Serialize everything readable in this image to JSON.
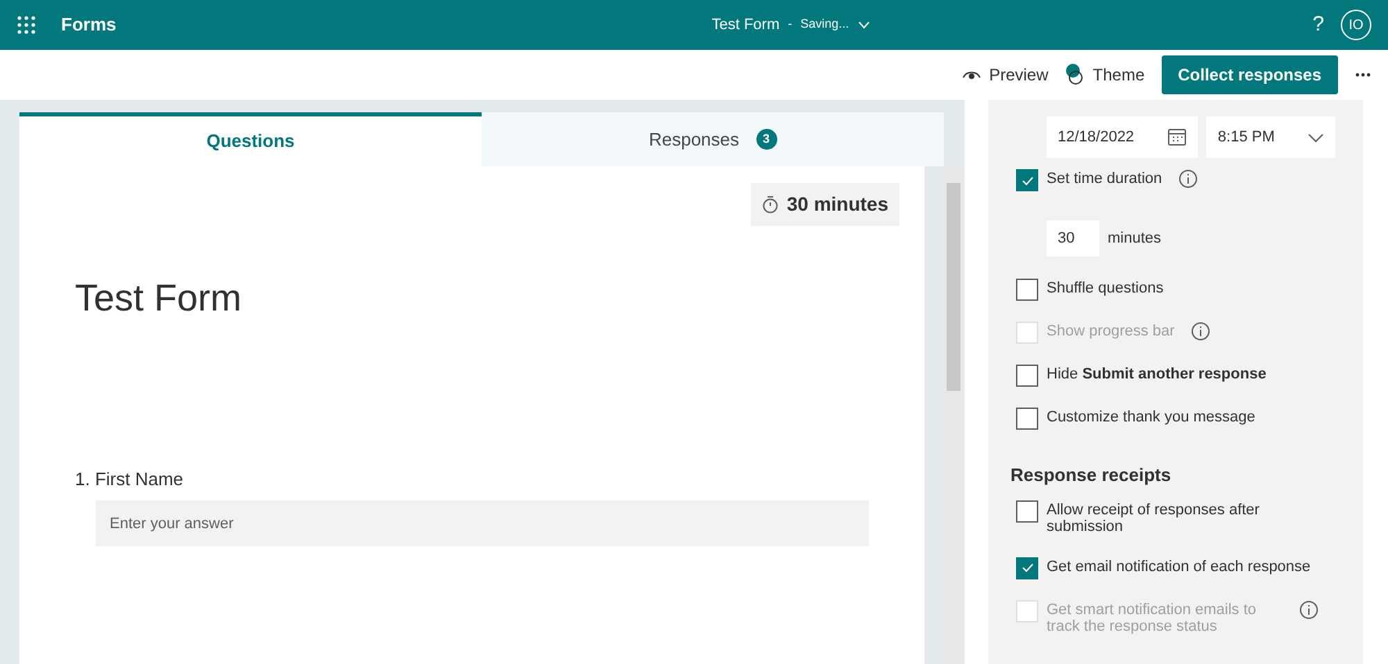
{
  "app_bar": {
    "app_name": "Forms",
    "form_title": "Test Form",
    "separator": "-",
    "save_status": "Saving...",
    "help": "?",
    "avatar": "IO"
  },
  "toolbar": {
    "preview": "Preview",
    "theme": "Theme",
    "collect": "Collect responses"
  },
  "tabs": [
    {
      "label": "Questions",
      "selected": true
    },
    {
      "label": "Responses",
      "selected": false,
      "count": "3"
    }
  ],
  "form": {
    "timer": "30 minutes",
    "title": "Test Form",
    "questions": [
      {
        "label": "1. First Name",
        "placeholder": "Enter your answer"
      }
    ]
  },
  "settings": [
    {
      "kind": "datetime",
      "date": "12/18/2022",
      "time": "8:15 PM"
    },
    {
      "kind": "checkbox",
      "label": "Set time duration",
      "checked": true,
      "disabled": false,
      "info": true
    },
    {
      "kind": "duration",
      "value": "30",
      "unit": "minutes"
    },
    {
      "kind": "checkbox",
      "label": "Shuffle questions",
      "checked": false,
      "disabled": false,
      "info": false
    },
    {
      "kind": "checkbox",
      "label": "Show progress bar",
      "checked": false,
      "disabled": true,
      "info": true
    },
    {
      "kind": "checkbox",
      "label": "Hide **Submit another response**",
      "checked": false,
      "disabled": false,
      "info": false
    },
    {
      "kind": "checkbox",
      "label": "Customize thank you message",
      "checked": false,
      "disabled": false,
      "info": false
    },
    {
      "kind": "heading",
      "label": "Response receipts"
    },
    {
      "kind": "checkbox",
      "label": "Allow receipt of responses after submission",
      "checked": false,
      "disabled": false,
      "info": false
    },
    {
      "kind": "checkbox",
      "label": "Get email notification of each response",
      "checked": true,
      "disabled": false,
      "info": false
    },
    {
      "kind": "checkbox",
      "label": "Get smart notification emails to track the response status",
      "checked": false,
      "disabled": true,
      "info": true
    }
  ]
}
